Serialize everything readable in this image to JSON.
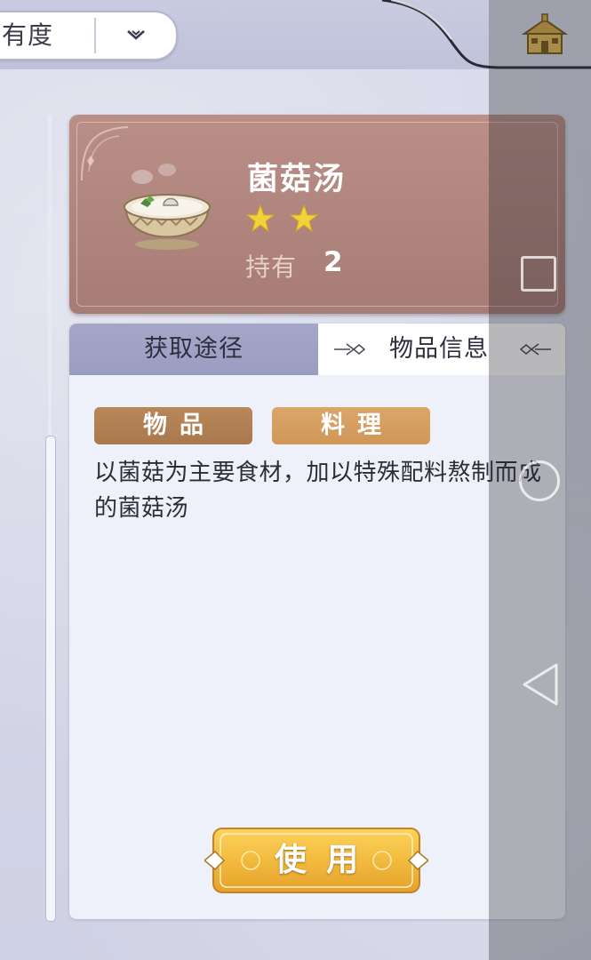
{
  "header": {
    "sort_label": "有度",
    "sort_icon": "chevron-down-icon",
    "home_icon": "home-icon"
  },
  "item": {
    "name": "菌菇汤",
    "stars": 2,
    "owned_label": "持有",
    "owned_count": "2",
    "icon": "mushroom-soup-icon"
  },
  "tabs": [
    {
      "label": "获取途径",
      "selected": false
    },
    {
      "label": "物品信息",
      "selected": true
    }
  ],
  "tags": [
    "物品",
    "料理"
  ],
  "description": "以菌菇为主要食材，加以特殊配料熬制而成的菌菇汤",
  "use_button": {
    "label": "使用"
  },
  "system_nav": [
    "recent-apps-icon",
    "home-circle-icon",
    "back-triangle-icon"
  ],
  "colors": {
    "card": "#a77c75",
    "tab_inactive": "#9a9dc0",
    "tag_item": "#a9784c",
    "tag_cooking": "#cf9759",
    "button_gold": "#f1b83c",
    "star": "#f2d23a"
  }
}
